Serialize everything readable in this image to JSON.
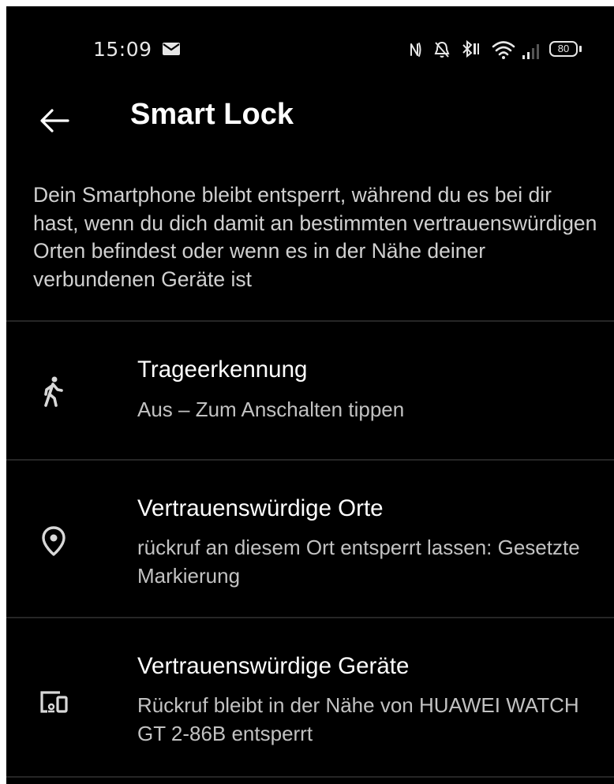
{
  "status_bar": {
    "time": "15:09",
    "battery": "80",
    "icons": [
      "mail-icon",
      "nfc-icon",
      "bell-off-icon",
      "bluetooth-icon",
      "wifi-icon",
      "signal-icon",
      "battery-icon"
    ]
  },
  "header": {
    "title": "Smart Lock",
    "back_icon": "arrow-left-icon"
  },
  "description": "Dein Smartphone bleibt entsperrt, während du es bei dir hast, wenn du dich damit an bestimmten vertrauenswürdigen Orten befindest oder wenn es in der Nähe deiner verbundenen Geräte ist",
  "items": [
    {
      "icon": "walking-person-icon",
      "title": "Trageerkennung",
      "subtitle": "Aus – Zum Anschalten tippen"
    },
    {
      "icon": "location-pin-icon",
      "title": "Vertrauenswürdige Orte",
      "subtitle": "rückruf an diesem Ort entsperrt lassen: Gesetzte Markierung"
    },
    {
      "icon": "devices-icon",
      "title": "Vertrauenswürdige Geräte",
      "subtitle": "Rückruf bleibt in der Nähe von HUAWEI WATCH GT 2-86B entsperrt"
    }
  ],
  "colors": {
    "background": "#000000",
    "text_primary": "#ffffff",
    "text_secondary": "#c2c2c2",
    "divider": "#262626"
  }
}
